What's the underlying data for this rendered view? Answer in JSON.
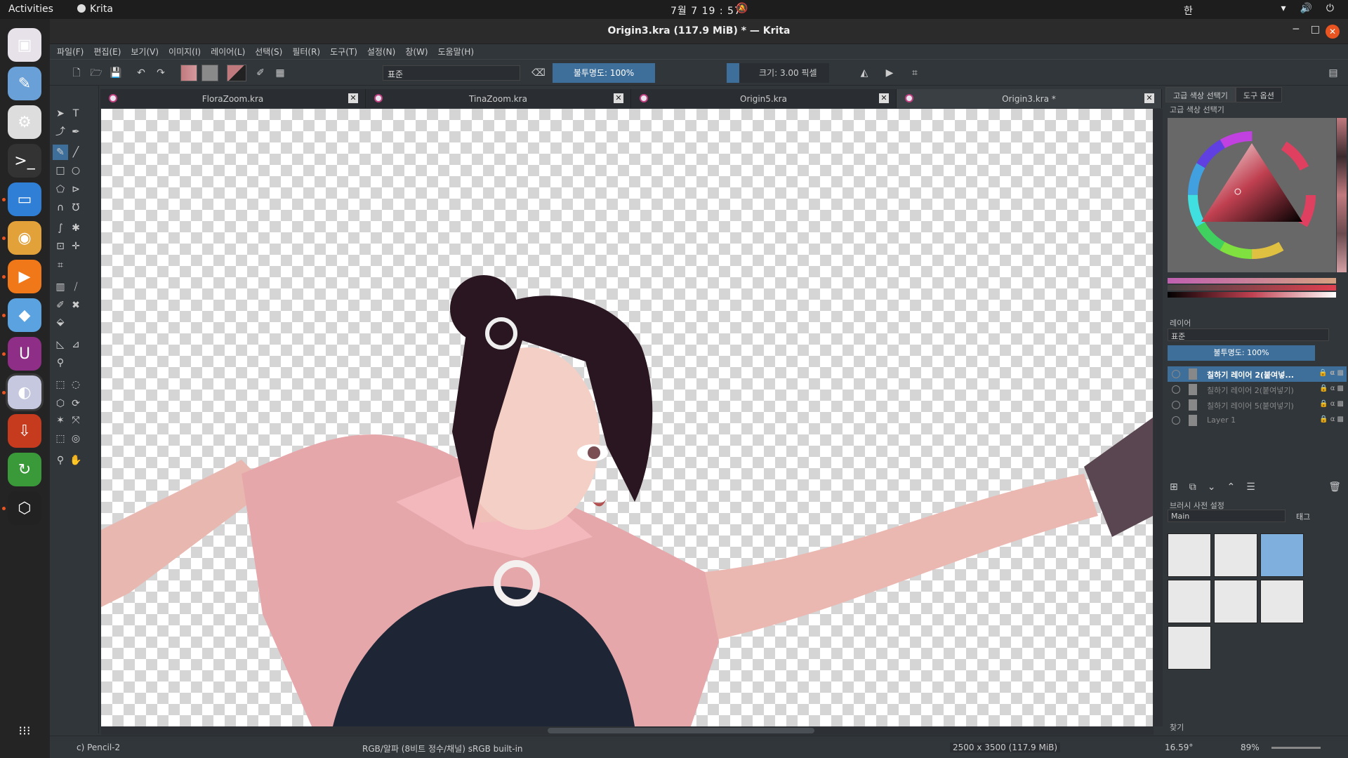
{
  "system_bar": {
    "activities": "Activities",
    "app_name": "Krita",
    "clock": "7월 7  19 : 57",
    "input_lang": "한"
  },
  "dock": {
    "apps": [
      {
        "name": "krita-doc",
        "glyph": "▣",
        "color": "#e7e2ea"
      },
      {
        "name": "pencil-app",
        "glyph": "✎",
        "color": "#6aa0d8"
      },
      {
        "name": "settings",
        "glyph": "⚙",
        "color": "#ddd"
      },
      {
        "name": "terminal",
        "glyph": ">_",
        "color": "#333"
      },
      {
        "name": "files",
        "glyph": "▭",
        "color": "#2f7fd6"
      },
      {
        "name": "chrome",
        "glyph": "◉",
        "color": "#e3a13a"
      },
      {
        "name": "media-player",
        "glyph": "▶",
        "color": "#f07818"
      },
      {
        "name": "foxit-reader",
        "glyph": "◆",
        "color": "#5aa3e0"
      },
      {
        "name": "unity-hub",
        "glyph": "U",
        "color": "#8e2e86"
      },
      {
        "name": "krita",
        "glyph": "◐",
        "color": "#c6c8e0"
      },
      {
        "name": "downloader",
        "glyph": "⇩",
        "color": "#c63a1e"
      },
      {
        "name": "update-manager",
        "glyph": "↻",
        "color": "#3a9a3a"
      },
      {
        "name": "unity",
        "glyph": "⬡",
        "color": "#222"
      }
    ],
    "show_apps": "⁝⁝⁝"
  },
  "window": {
    "title": "Origin3.kra (117.9 MiB)  * — Krita"
  },
  "menu": [
    "파일(F)",
    "편집(E)",
    "보기(V)",
    "이미지(I)",
    "레이어(L)",
    "선택(S)",
    "필터(R)",
    "도구(T)",
    "설정(N)",
    "창(W)",
    "도움말(H)"
  ],
  "toolbar": {
    "blend_mode": "표준",
    "opacity": "불투명도: 100%",
    "size": "크기: 3.00 픽셀",
    "fg_color": "#c07a7e",
    "bg_color": "#8a8a8a"
  },
  "tabs": [
    {
      "label": "FloraZoom.kra"
    },
    {
      "label": "TinaZoom.kra"
    },
    {
      "label": "Origin5.kra"
    },
    {
      "label": "Origin3.kra *"
    }
  ],
  "right_panel": {
    "tab1": "고급 색상 선택기",
    "tab2": "도구 옵션",
    "color_section": "고급 색상 선택기",
    "layers_title": "레이어",
    "layer_blend": "표준",
    "layer_opacity": "불투명도: 100%",
    "layers": [
      {
        "name": "칠하기 레이어 2(붙여넣...",
        "selected": true
      },
      {
        "name": "칠하기 레이어 2(붙여넣기)",
        "selected": false
      },
      {
        "name": "칠하기 레이어 5(붙여넣기)",
        "selected": false
      },
      {
        "name": "Layer 1",
        "selected": false
      }
    ],
    "brush_title": "브러시 사전 설정",
    "brush_tag": "Main",
    "brush_tag_label": "태그",
    "search_label": "찾기"
  },
  "status": {
    "brush": "c) Pencil-2",
    "color_space": "RGB/알파 (8비트 정수/채널)  sRGB built-in",
    "image_size": "2500 x 3500 (117.9 MiB)",
    "angle": "16.59°",
    "zoom": "89%"
  }
}
